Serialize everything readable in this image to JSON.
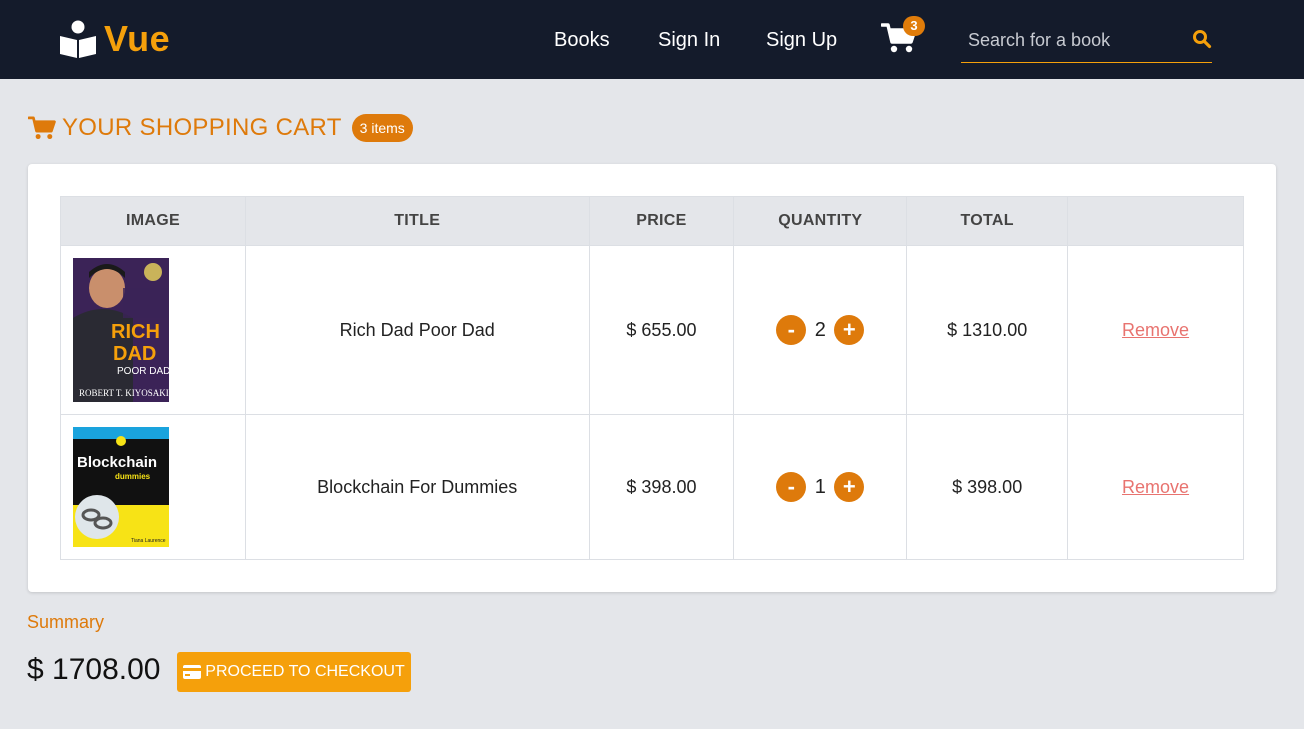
{
  "nav": {
    "brand": "Vue",
    "brand_icon": "book-reader-icon",
    "links": {
      "books": "Books",
      "sign_in": "Sign In",
      "sign_up": "Sign Up"
    },
    "cart_icon": "cart-icon",
    "cart_count": "3",
    "search": {
      "placeholder": "Search for a book",
      "value": "",
      "icon": "search-icon"
    }
  },
  "cart": {
    "heading": "YOUR SHOPPING CART",
    "badge": "3 items",
    "columns": {
      "image": "IMAGE",
      "title": "TITLE",
      "price": "PRICE",
      "quantity": "QUANTITY",
      "total": "TOTAL",
      "actions": ""
    },
    "items": [
      {
        "cover": {
          "top_label": "",
          "title_line1": "RICH",
          "title_line2": "DAD",
          "subtitle": "POOR DAD",
          "author": "ROBERT T. KIYOSAKI"
        },
        "title": "Rich Dad Poor Dad",
        "price": "$ 655.00",
        "minus": "-",
        "quantity": "2",
        "plus": "+",
        "total": "$ 1310.00",
        "remove": "Remove"
      },
      {
        "cover": {
          "title_line1": "Blockchain",
          "title_line2": "dummies",
          "author": "Tiana Laurence"
        },
        "title": "Blockchain For Dummies",
        "price": "$ 398.00",
        "minus": "-",
        "quantity": "1",
        "plus": "+",
        "total": "$ 398.00",
        "remove": "Remove"
      }
    ]
  },
  "summary": {
    "label": "Summary",
    "total": "$ 1708.00",
    "checkout_label": "PROCEED TO CHECKOUT",
    "checkout_icon": "credit-card-icon"
  },
  "colors": {
    "navbar_bg": "#141b2b",
    "accent": "#f5a00b",
    "accent_dark": "#de7a0b",
    "remove_link": "#e8736f",
    "page_bg": "#e4e6ea"
  }
}
